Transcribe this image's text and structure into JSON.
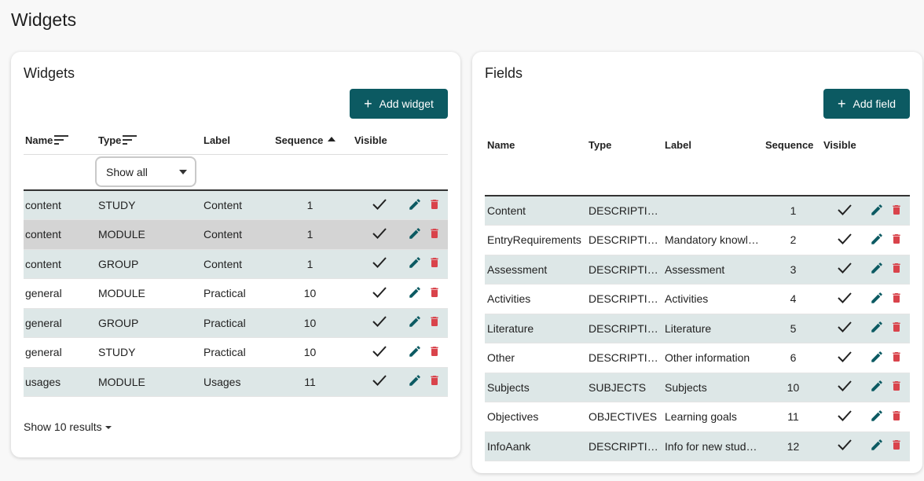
{
  "page": {
    "title": "Widgets"
  },
  "widgets": {
    "title": "Widgets",
    "add_label": "Add widget",
    "columns": {
      "name": "Name",
      "type": "Type",
      "label": "Label",
      "sequence": "Sequence",
      "visible": "Visible"
    },
    "filter": {
      "selected": "Show all"
    },
    "rows": [
      {
        "name": "content",
        "type": "STUDY",
        "label": "Content",
        "sequence": "1",
        "visible": true
      },
      {
        "name": "content",
        "type": "MODULE",
        "label": "Content",
        "sequence": "1",
        "visible": true
      },
      {
        "name": "content",
        "type": "GROUP",
        "label": "Content",
        "sequence": "1",
        "visible": true
      },
      {
        "name": "general",
        "type": "MODULE",
        "label": "Practical",
        "sequence": "10",
        "visible": true
      },
      {
        "name": "general",
        "type": "GROUP",
        "label": "Practical",
        "sequence": "10",
        "visible": true
      },
      {
        "name": "general",
        "type": "STUDY",
        "label": "Practical",
        "sequence": "10",
        "visible": true
      },
      {
        "name": "usages",
        "type": "MODULE",
        "label": "Usages",
        "sequence": "11",
        "visible": true
      }
    ],
    "page_size_label": "Show 10 results"
  },
  "fields": {
    "title": "Fields",
    "add_label": "Add field",
    "columns": {
      "name": "Name",
      "type": "Type",
      "label": "Label",
      "sequence": "Sequence",
      "visible": "Visible"
    },
    "rows": [
      {
        "name": "Content",
        "type": "DESCRIPTION",
        "label": "",
        "sequence": "1",
        "visible": true
      },
      {
        "name": "EntryRequirements",
        "type": "DESCRIPTION",
        "label": "Mandatory knowl…",
        "sequence": "2",
        "visible": true
      },
      {
        "name": "Assessment",
        "type": "DESCRIPTION",
        "label": "Assessment",
        "sequence": "3",
        "visible": true
      },
      {
        "name": "Activities",
        "type": "DESCRIPTION",
        "label": "Activities",
        "sequence": "4",
        "visible": true
      },
      {
        "name": "Literature",
        "type": "DESCRIPTION",
        "label": "Literature",
        "sequence": "5",
        "visible": true
      },
      {
        "name": "Other",
        "type": "DESCRIPTION",
        "label": "Other information",
        "sequence": "6",
        "visible": true
      },
      {
        "name": "Subjects",
        "type": "SUBJECTS",
        "label": "Subjects",
        "sequence": "10",
        "visible": true
      },
      {
        "name": "Objectives",
        "type": "OBJECTIVES",
        "label": "Learning goals",
        "sequence": "11",
        "visible": true
      },
      {
        "name": "InfoAank",
        "type": "DESCRIPTION",
        "label": "Info for new stud…",
        "sequence": "12",
        "visible": true
      }
    ]
  },
  "colors": {
    "primary": "#0c5a62",
    "row_shade": "#dde7e7",
    "row_hover": "#d4d4d4",
    "edit": "#0c5a62",
    "delete": "#d9434b"
  },
  "icons": {
    "add": "plus-icon",
    "edit": "pencil-icon",
    "delete": "trash-icon",
    "visible": "check-icon",
    "sort": "sort-lines-icon",
    "ascending": "sort-ascending-icon"
  }
}
